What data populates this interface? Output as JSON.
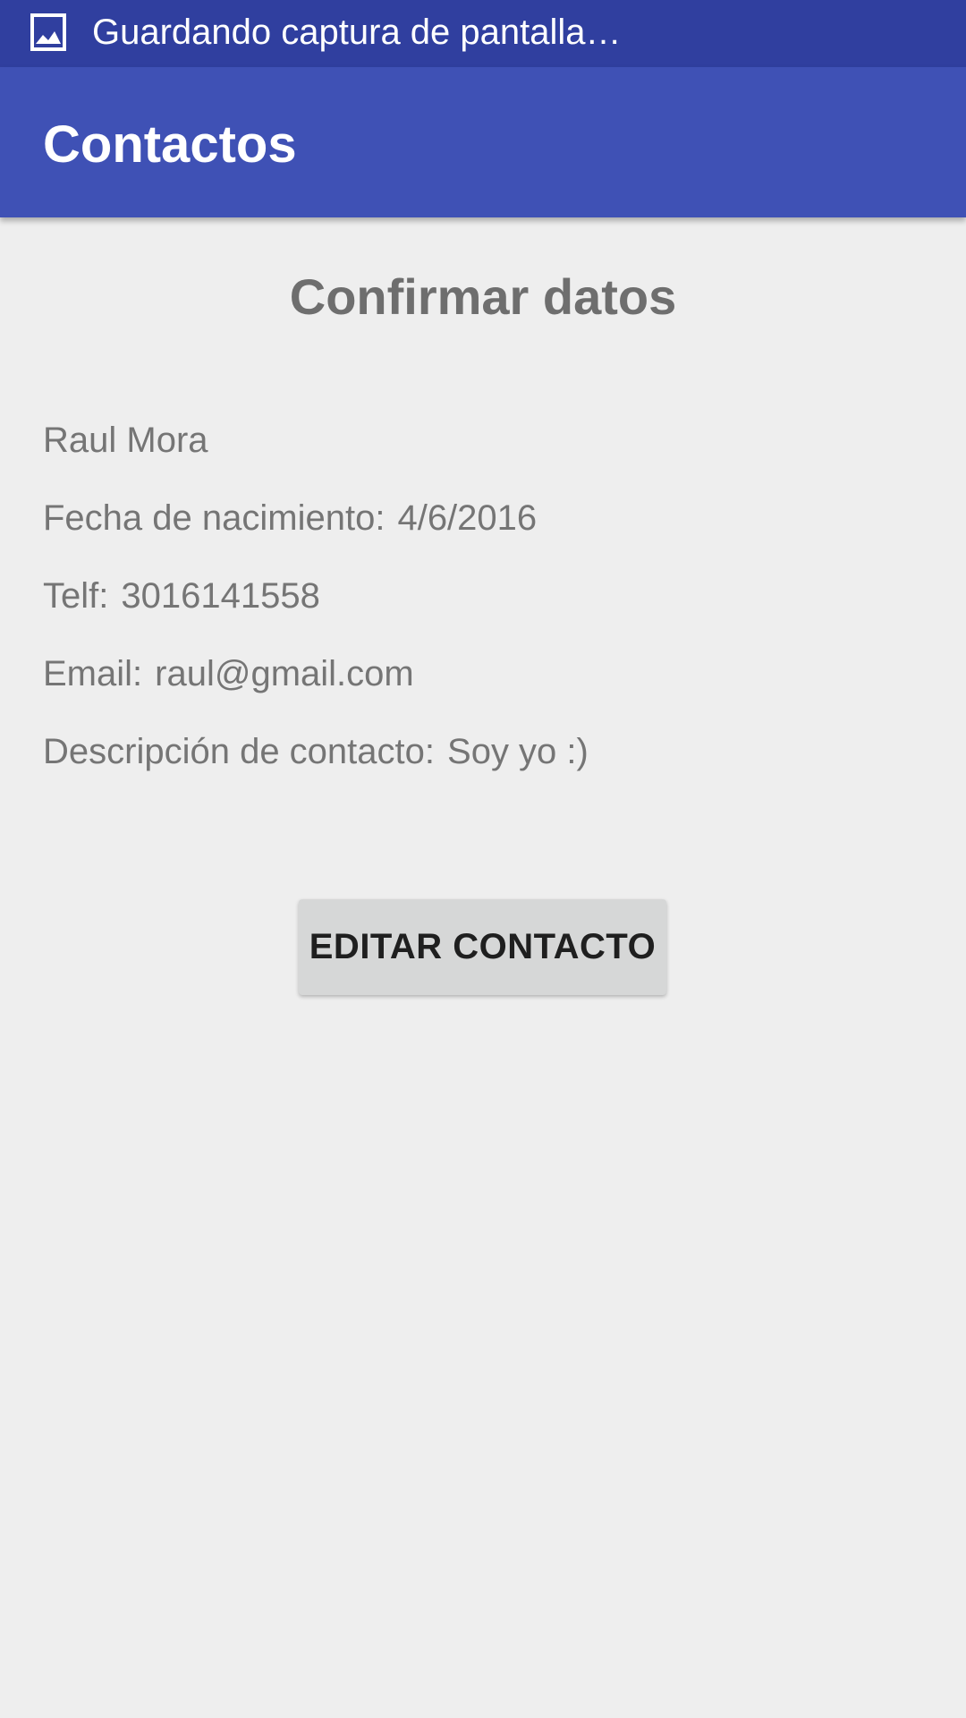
{
  "status_bar": {
    "icon": "image-icon",
    "notification_text": "Guardando captura de pantalla…",
    "background_color": "#303f9f"
  },
  "app_bar": {
    "title": "Contactos",
    "background_color": "#3f51b5"
  },
  "main": {
    "heading": "Confirmar datos",
    "name": "Raul Mora",
    "birth_date": {
      "label": "Fecha de nacimiento:",
      "value": "4/6/2016"
    },
    "phone": {
      "label": "Telf:",
      "value": "3016141558"
    },
    "email": {
      "label": "Email:",
      "value": "raul@gmail.com"
    },
    "description": {
      "label": "Descripción de contacto:",
      "value": "Soy yo :)"
    },
    "edit_button_label": "EDITAR CONTACTO"
  }
}
